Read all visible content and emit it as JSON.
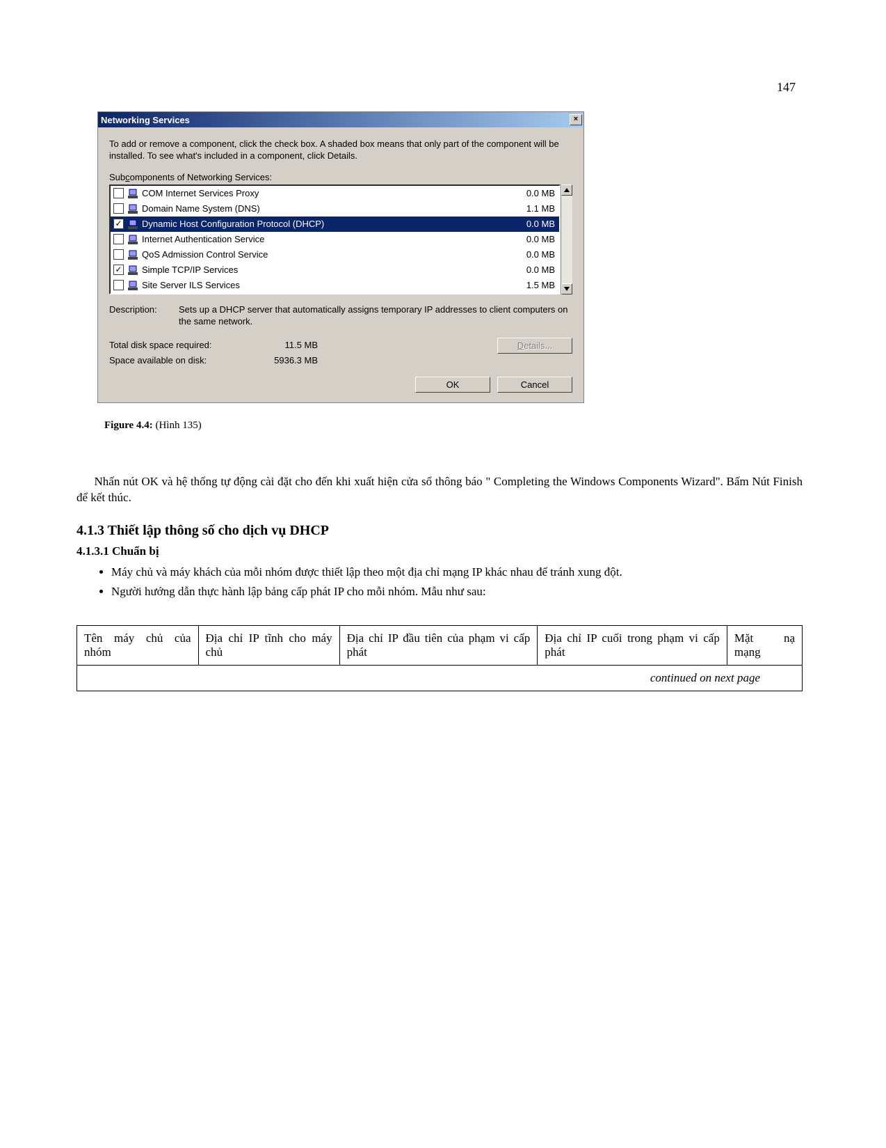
{
  "page_number": "147",
  "dialog": {
    "title": "Networking Services",
    "instruction": "To add or remove a component, click the check box. A shaded box means that only part of the component will be installed. To see what's included in a component, click Details.",
    "subcomponents_label_pre": "Sub",
    "subcomponents_label_c": "c",
    "subcomponents_label_post": "omponents of Networking Services:",
    "items": [
      {
        "checked": false,
        "label": "COM Internet Services Proxy",
        "size": "0.0 MB",
        "selected": false
      },
      {
        "checked": false,
        "label": "Domain Name System (DNS)",
        "size": "1.1 MB",
        "selected": false
      },
      {
        "checked": true,
        "label": "Dynamic Host Configuration Protocol (DHCP)",
        "size": "0.0 MB",
        "selected": true
      },
      {
        "checked": false,
        "label": "Internet Authentication Service",
        "size": "0.0 MB",
        "selected": false
      },
      {
        "checked": false,
        "label": "QoS Admission Control Service",
        "size": "0.0 MB",
        "selected": false
      },
      {
        "checked": true,
        "label": "Simple TCP/IP Services",
        "size": "0.0 MB",
        "selected": false
      },
      {
        "checked": false,
        "label": "Site Server ILS Services",
        "size": "1.5 MB",
        "selected": false
      }
    ],
    "description_label": "Description:",
    "description_text": "Sets up a DHCP server that automatically assigns temporary IP addresses to client computers on the same network.",
    "total_label": "Total disk space required:",
    "total_value": "11.5 MB",
    "avail_label": "Space available on disk:",
    "avail_value": "5936.3 MB",
    "details_button_pre": "",
    "details_button_d": "D",
    "details_button_post": "etails...",
    "ok_button": "OK",
    "cancel_button": "Cancel"
  },
  "figure_caption_bold": "Figure 4.4:",
  "figure_caption_rest": " (Hình 135)",
  "paragraph": "Nhấn nút OK và hệ thống tự động cài đặt cho đến khi xuất hiện cửa sổ thông báo \" Completing the Windows Components Wizard\". Bấm Nút Finish để kết thúc.",
  "heading3": "4.1.3 Thiết lập thông số cho dịch vụ DHCP",
  "heading4": "4.1.3.1 Chuẩn bị",
  "bullets": [
    "Máy chủ và máy khách của mỗi nhóm được thiết lập theo một địa chỉ mạng IP khác nhau để tránh xung đột.",
    "Người hướng dẫn thực hành lập bảng cấp phát IP cho mỗi nhóm. Mẫu như sau:"
  ],
  "table": {
    "headers": [
      "Tên máy chủ của nhóm",
      "Địa chỉ IP tĩnh cho máy chủ",
      "Địa chỉ IP đầu tiên của phạm vi cấp phát",
      "Địa chỉ IP cuối trong phạm vi cấp phát",
      "Mặt nạ mạng"
    ],
    "continued": "continued on next page"
  }
}
